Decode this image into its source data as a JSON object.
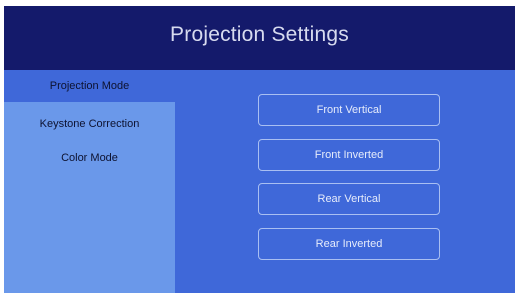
{
  "header": {
    "title": "Projection Settings"
  },
  "sidebar": {
    "items": [
      {
        "label": "Projection Mode",
        "active": true
      },
      {
        "label": "Keystone Correction",
        "active": false
      },
      {
        "label": "Color Mode",
        "active": false
      }
    ]
  },
  "main": {
    "options": [
      {
        "label": "Front Vertical"
      },
      {
        "label": "Front Inverted"
      },
      {
        "label": "Rear Vertical"
      },
      {
        "label": "Rear Inverted"
      }
    ]
  },
  "colors": {
    "header_bg": "#141a6b",
    "content_bg": "#3f68d9",
    "sidebar_bg": "#6a98ea",
    "button_border": "#a9bff2"
  }
}
